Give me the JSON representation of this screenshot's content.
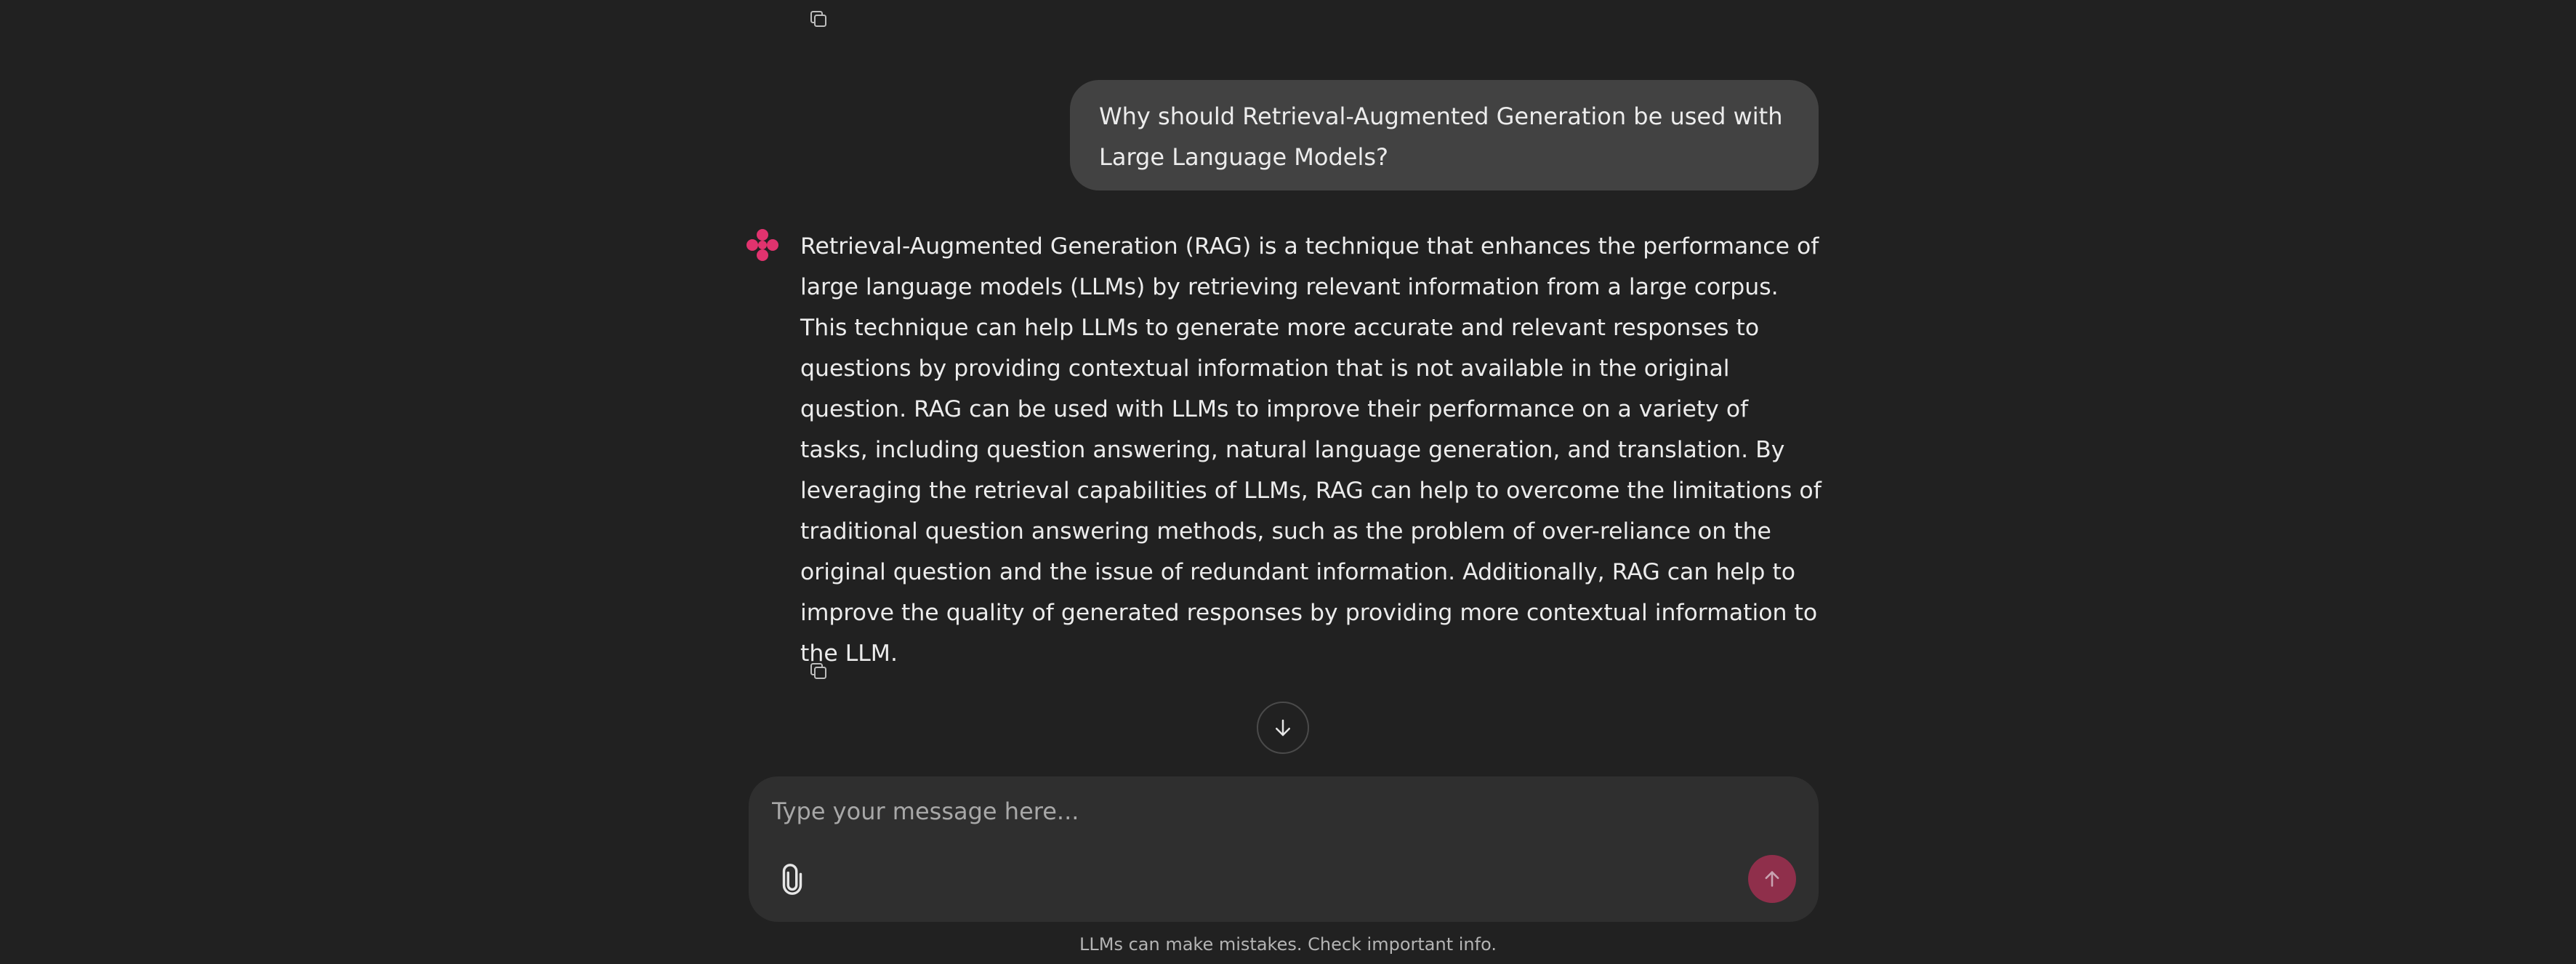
{
  "conversation": {
    "user_message": "Why should Retrieval-Augmented Generation be used with Large Language Models?",
    "assistant_message": "Retrieval-Augmented Generation (RAG) is a technique that enhances the performance of large language models (LLMs) by retrieving relevant information from a large corpus. This technique can help LLMs to generate more accurate and relevant responses to questions by providing contextual information that is not available in the original question. RAG can be used with LLMs to improve their performance on a variety of tasks, including question answering, natural language generation, and translation. By leveraging the retrieval capabilities of LLMs, RAG can help to overcome the limitations of traditional question answering methods, such as the problem of over-reliance on the original question and the issue of redundant information. Additionally, RAG can help to improve the quality of generated responses by providing more contextual information to the LLM."
  },
  "composer": {
    "placeholder": "Type your message here..."
  },
  "footer": {
    "disclaimer": "LLMs can make mistakes. Check important info."
  },
  "icons": {
    "copy": "copy-icon",
    "assistant_avatar": "assistant-logo-icon",
    "scroll_down": "arrow-down-icon",
    "attach": "paperclip-icon",
    "send": "arrow-up-icon"
  },
  "colors": {
    "background": "#212121",
    "user_bubble": "#424242",
    "composer": "#2f2f2f",
    "accent": "#e0336e",
    "send_button": "#8f2f4b",
    "text": "#ececec",
    "muted_text": "#b4b4b4"
  }
}
